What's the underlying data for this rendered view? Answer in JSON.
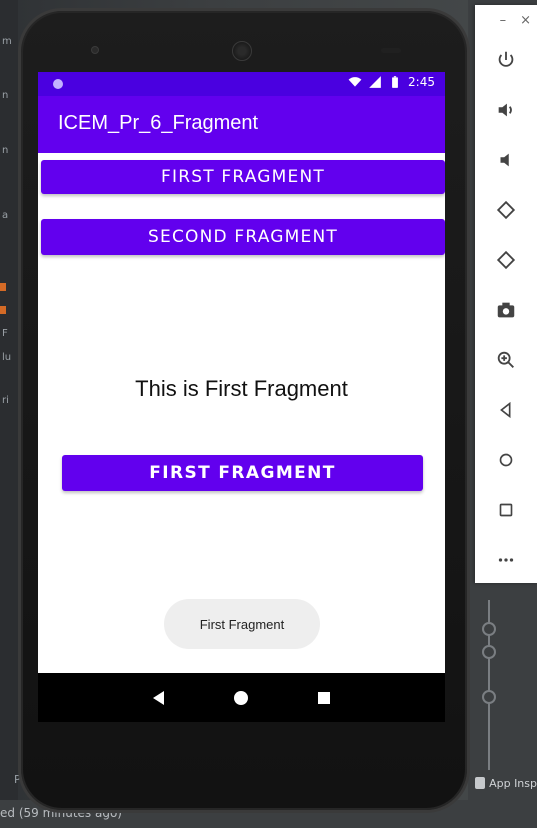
{
  "ide": {
    "status_text": "ed (59 minutes ago)",
    "app_inspection_label": "App Insp",
    "left_tool_label": "Pr"
  },
  "emulator_panel": {
    "minimize_label": "–",
    "close_label": "×",
    "buttons": [
      "power-icon",
      "volume-up-icon",
      "volume-down-icon",
      "rotate-left-icon",
      "rotate-right-icon",
      "camera-icon",
      "zoom-in-icon",
      "back-icon",
      "home-icon",
      "overview-icon",
      "more-icon"
    ]
  },
  "device": {
    "status_bar": {
      "time": "2:45"
    },
    "app_bar": {
      "title": "ICEM_Pr_6_Fragment"
    },
    "buttons": {
      "first_fragment": "FIRST FRAGMENT",
      "second_fragment": "SECOND FRAGMENT"
    },
    "fragment": {
      "text": "This is First Fragment",
      "button_label": "FIRST FRAGMENT"
    },
    "toast": "First Fragment"
  },
  "colors": {
    "primary": "#6200ee",
    "primary_dark": "#4a00e0",
    "white": "#ffffff",
    "nav_bar": "#000000"
  }
}
